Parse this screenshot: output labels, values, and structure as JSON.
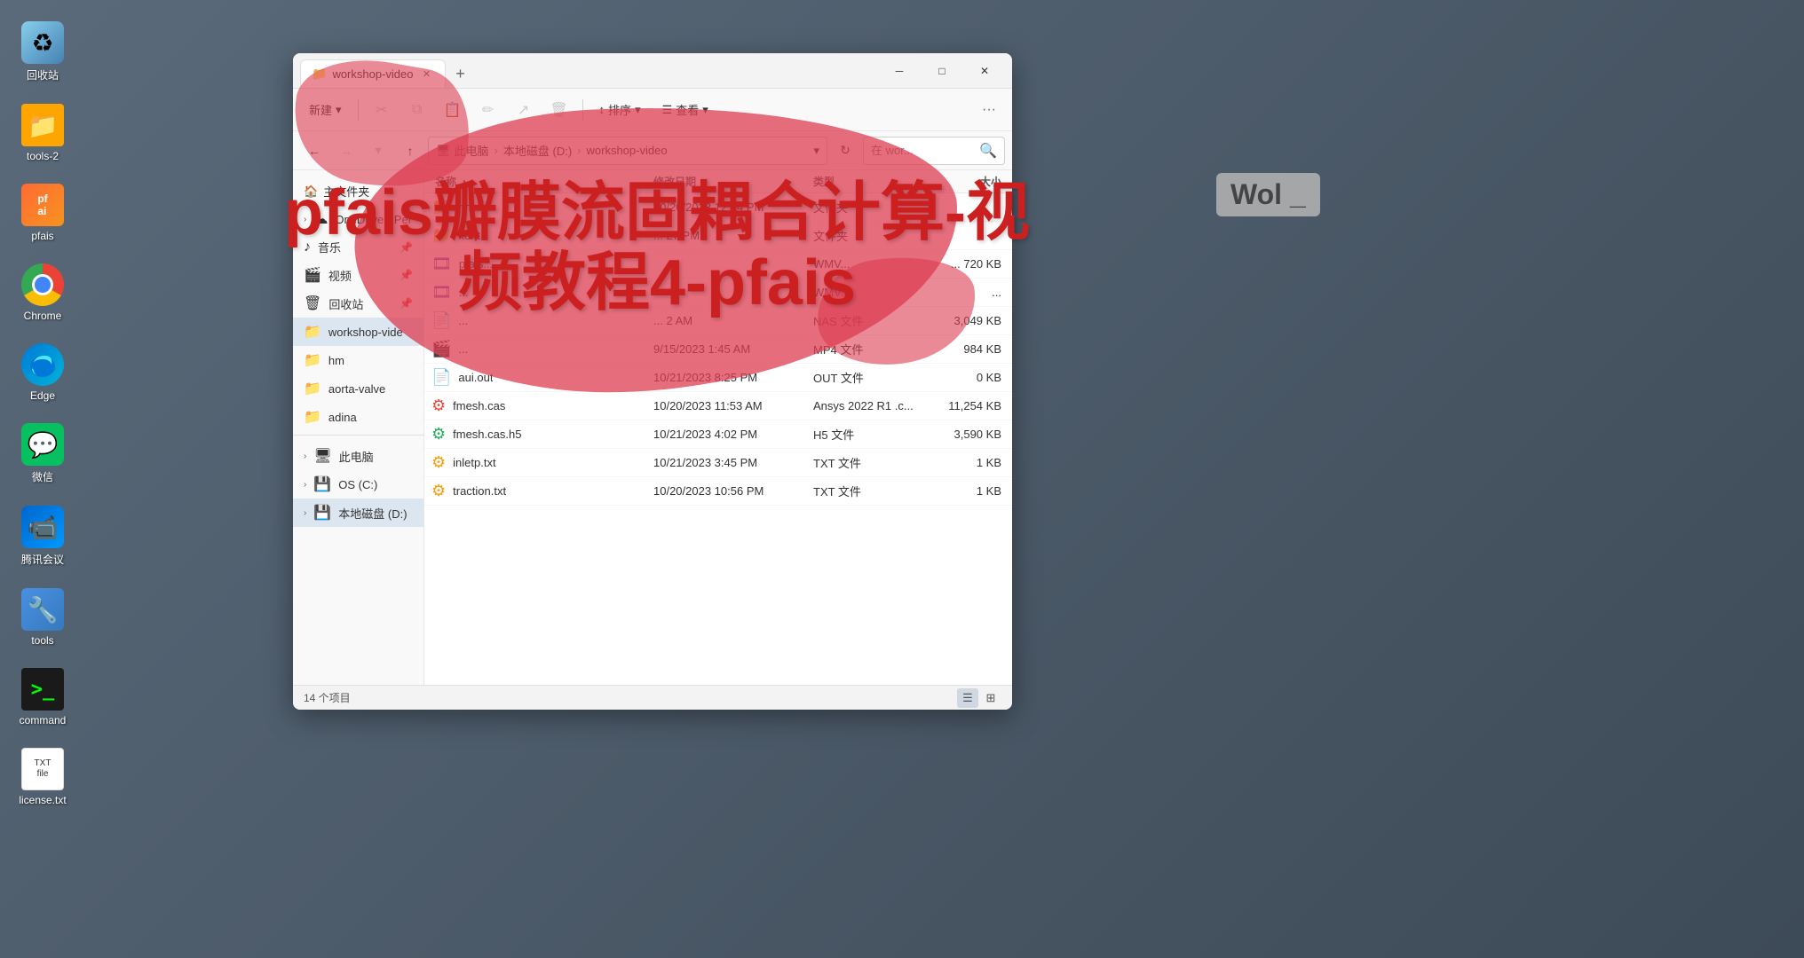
{
  "desktop": {
    "background": "#4a6070"
  },
  "desktop_icons": [
    {
      "id": "recycle-bin",
      "label": "回收站",
      "icon_type": "recycle"
    },
    {
      "id": "tools-2",
      "label": "tools-2",
      "icon_type": "folder-orange"
    },
    {
      "id": "pfais",
      "label": "pfais",
      "icon_type": "pfais"
    },
    {
      "id": "chrome",
      "label": "Chrome",
      "icon_type": "chrome"
    },
    {
      "id": "edge",
      "label": "Edge",
      "icon_type": "edge"
    },
    {
      "id": "wechat",
      "label": "微信",
      "icon_type": "wechat"
    },
    {
      "id": "tencent",
      "label": "腾讯会议",
      "icon_type": "tencent"
    },
    {
      "id": "tools",
      "label": "tools",
      "icon_type": "tools"
    },
    {
      "id": "command",
      "label": "command",
      "icon_type": "command"
    },
    {
      "id": "license",
      "label": "license.txt",
      "icon_type": "license"
    }
  ],
  "window": {
    "tab_label": "workshop-video",
    "tab_icon": "📁",
    "close_btn": "✕",
    "maximize_btn": "□",
    "minimize_btn": "─",
    "add_tab_btn": "+"
  },
  "toolbar": {
    "new_btn": "新建",
    "new_arrow": "▾",
    "cut_icon": "✂",
    "copy_icon": "⧉",
    "paste_icon": "📋",
    "rename_icon": "✏",
    "share_icon": "↗",
    "delete_icon": "🗑",
    "sort_btn": "排序",
    "sort_arrow": "▾",
    "view_btn": "查看",
    "view_arrow": "▾",
    "more_btn": "···"
  },
  "address_bar": {
    "back_btn": "←",
    "forward_btn": "→",
    "up_btn": "↑",
    "path_pc": "此电脑",
    "path_drive": "本地磁盘 (D:)",
    "path_folder": "workshop-video",
    "path_icon": "🖥",
    "refresh_btn": "↻",
    "search_placeholder": "在 wor...",
    "search_icon": "🔍",
    "path_dropdown": "▾"
  },
  "sidebar": {
    "quick_access_label": "主文件夹",
    "quick_access_icon": "🏠",
    "onedrive_label": "OneDrive - Per",
    "onedrive_icon": "☁",
    "onedrive_expand": "›",
    "items": [
      {
        "id": "music",
        "label": "音乐",
        "icon": "♪",
        "pinned": true
      },
      {
        "id": "video",
        "label": "视频",
        "icon": "🎬",
        "pinned": true
      },
      {
        "id": "recycle",
        "label": "回收站",
        "icon": "🗑",
        "pinned": true
      },
      {
        "id": "workshop-video",
        "label": "workshop-vide",
        "icon": "📁"
      },
      {
        "id": "hm",
        "label": "hm",
        "icon": "📁"
      },
      {
        "id": "aorta-valve",
        "label": "aorta-valve",
        "icon": "📁"
      },
      {
        "id": "adina",
        "label": "adina",
        "icon": "📁"
      },
      {
        "id": "this-pc",
        "label": "此电脑",
        "icon": "🖥",
        "expand": "›"
      },
      {
        "id": "os-c",
        "label": "OS (C:)",
        "icon": "💾",
        "expand": "›"
      },
      {
        "id": "local-d",
        "label": "本地磁盘 (D:)",
        "icon": "💾",
        "expand": "›",
        "selected": true
      }
    ]
  },
  "file_list": {
    "columns": {
      "name": "名称",
      "name_sort": "∧",
      "date": "修改日期",
      "type": "类型",
      "size": "大小"
    },
    "files": [
      {
        "name": "hm",
        "icon_type": "folder",
        "date": "10/20/2023 12:04 PM",
        "type": "文件夹",
        "size": ""
      },
      {
        "name": "kent",
        "icon_type": "folder",
        "date": "... 27 PM",
        "type": "文件夹",
        "size": ""
      },
      {
        "name": "pfais...",
        "icon_type": "wmv",
        "date": "",
        "type": "WMV...",
        "size": "... 720 KB"
      },
      {
        "name": "...",
        "icon_type": "wmv",
        "date": "",
        "type": "WMV...",
        "size": "..."
      },
      {
        "name": "...",
        "icon_type": "nas",
        "date": "... 2 AM",
        "type": "NAS 文件",
        "size": "3,049 KB"
      },
      {
        "name": "...",
        "icon_type": "mp4",
        "date": "9/15/2023 1:45 AM",
        "type": "MP4 文件",
        "size": "984 KB"
      },
      {
        "name": "aui.out",
        "icon_type": "out",
        "date": "10/21/2023 8:25 PM",
        "type": "OUT 文件",
        "size": "0 KB"
      },
      {
        "name": "fmesh.cas",
        "icon_type": "cas",
        "date": "10/20/2023 11:53 AM",
        "type": "Ansys 2022 R1 .c...",
        "size": "11,254 KB"
      },
      {
        "name": "fmesh.cas.h5",
        "icon_type": "h5",
        "date": "10/21/2023 4:02 PM",
        "type": "H5 文件",
        "size": "3,590 KB"
      },
      {
        "name": "inletp.txt",
        "icon_type": "txt",
        "date": "10/21/2023 3:45 PM",
        "type": "TXT 文件",
        "size": "1 KB"
      },
      {
        "name": "traction.txt",
        "icon_type": "txt",
        "date": "10/20/2023 10:56 PM",
        "type": "TXT 文件",
        "size": "1 KB"
      }
    ]
  },
  "status_bar": {
    "count_label": "14 个项目",
    "view_list_icon": "☰",
    "view_grid_icon": "⊞"
  },
  "watermark": {
    "line1": "pfais瓣膜流固耦合计算-视",
    "line2": "频教程4-pfais"
  },
  "wol_badge": {
    "text": "Wol _"
  }
}
